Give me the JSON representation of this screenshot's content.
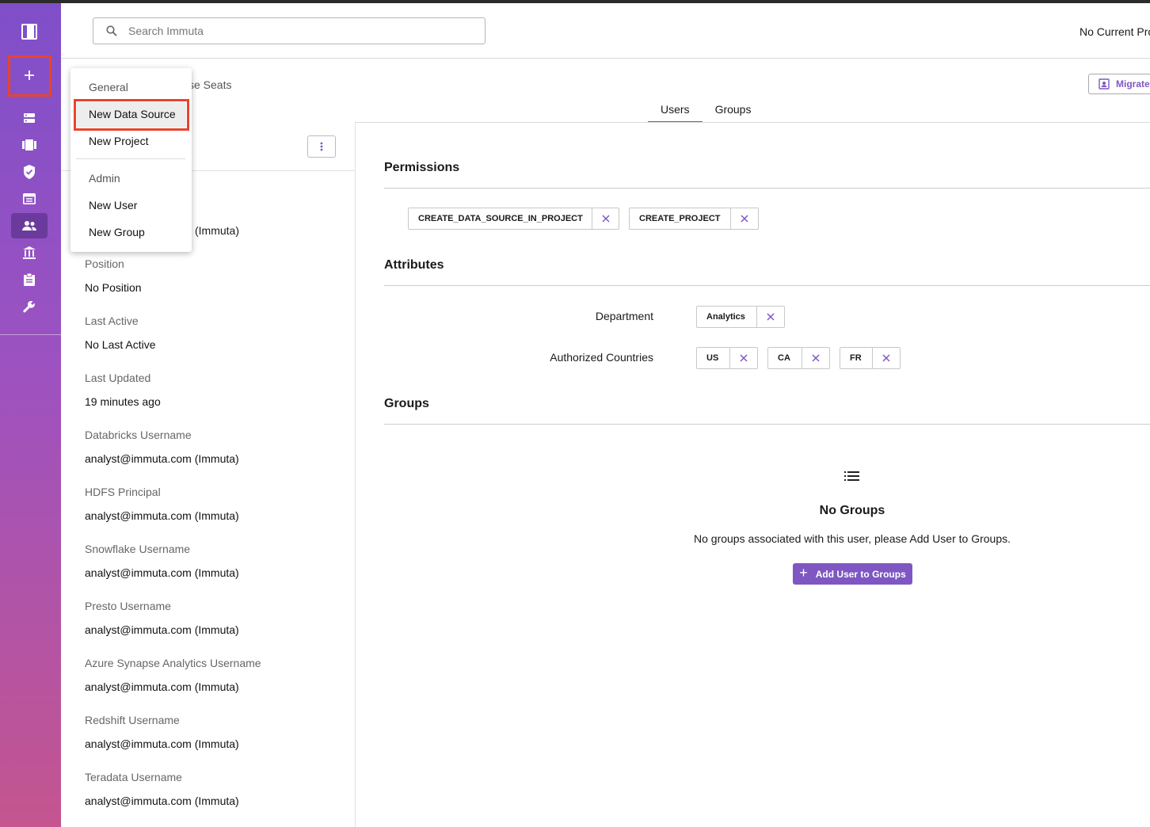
{
  "app": {
    "accent_color": "#7e57c2",
    "highlight_color": "#e8442b"
  },
  "sidebar": {
    "logo_icon": "immuta-logo-icon",
    "add_icon": "plus-icon",
    "items": [
      {
        "icon": "data-sources-icon"
      },
      {
        "icon": "projects-icon"
      },
      {
        "icon": "policies-icon"
      },
      {
        "icon": "query-editor-icon"
      },
      {
        "icon": "people-icon",
        "active": true
      },
      {
        "icon": "governance-icon"
      },
      {
        "icon": "audit-icon"
      },
      {
        "icon": "app-settings-icon"
      }
    ]
  },
  "topbar": {
    "search_placeholder": "Search Immuta",
    "current_project": "No Current Project"
  },
  "header": {
    "seats_label": "se Seats",
    "migrate_label": "Migrate",
    "tabs": [
      {
        "label": "Users",
        "active": true
      },
      {
        "label": "Groups",
        "active": false
      }
    ]
  },
  "menu": {
    "general_header": "General",
    "new_data_source": "New Data Source",
    "new_project": "New Project",
    "admin_header": "Admin",
    "new_user": "New User",
    "new_group": "New Group"
  },
  "user_details": {
    "partial_value": "(Immuta)",
    "fields": [
      {
        "label": "Position",
        "value": "No Position"
      },
      {
        "label": "Last Active",
        "value": "No Last Active"
      },
      {
        "label": "Last Updated",
        "value": "19 minutes ago"
      },
      {
        "label": "Databricks Username",
        "value": "analyst@immuta.com (Immuta)"
      },
      {
        "label": "HDFS Principal",
        "value": "analyst@immuta.com (Immuta)"
      },
      {
        "label": "Snowflake Username",
        "value": "analyst@immuta.com (Immuta)"
      },
      {
        "label": "Presto Username",
        "value": "analyst@immuta.com (Immuta)"
      },
      {
        "label": "Azure Synapse Analytics Username",
        "value": "analyst@immuta.com (Immuta)"
      },
      {
        "label": "Redshift Username",
        "value": "analyst@immuta.com (Immuta)"
      },
      {
        "label": "Teradata Username",
        "value": "analyst@immuta.com (Immuta)"
      }
    ]
  },
  "permissions": {
    "title": "Permissions",
    "items": [
      "CREATE_DATA_SOURCE_IN_PROJECT",
      "CREATE_PROJECT"
    ]
  },
  "attributes": {
    "title": "Attributes",
    "department_label": "Department",
    "department_values": [
      "Analytics"
    ],
    "countries_label": "Authorized Countries",
    "countries_values": [
      "US",
      "CA",
      "FR"
    ]
  },
  "groups": {
    "title": "Groups",
    "empty_title": "No Groups",
    "empty_desc": "No groups associated with this user, please Add User to Groups.",
    "add_button": "Add User to Groups"
  }
}
